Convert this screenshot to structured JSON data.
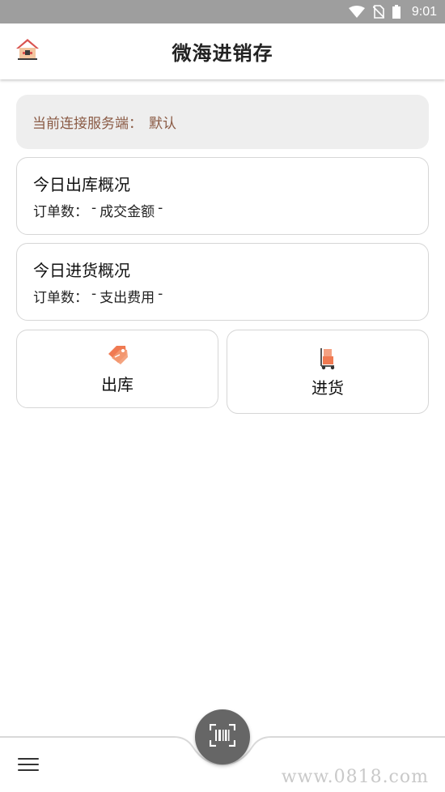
{
  "status_bar": {
    "time": "9:01",
    "icons": [
      "wifi-icon",
      "no-sim-icon",
      "battery-icon"
    ]
  },
  "app_bar": {
    "title": "微海进销存",
    "home_icon": "home-icon"
  },
  "server": {
    "label": "当前连接服务端：",
    "value": "默认"
  },
  "outbound_summary": {
    "title": "今日出库概况",
    "orders_label": "订单数：",
    "orders_value": "-",
    "amount_label": "成交金额",
    "amount_value": "-"
  },
  "inbound_summary": {
    "title": "今日进货概况",
    "orders_label": "订单数：",
    "orders_value": "-",
    "cost_label": "支出费用",
    "cost_value": "-"
  },
  "actions": {
    "outbound": {
      "label": "出库",
      "icon": "price-tag-icon"
    },
    "inbound": {
      "label": "进货",
      "icon": "hand-truck-icon"
    }
  },
  "bottom_bar": {
    "menu_icon": "menu-icon",
    "scan_icon": "barcode-scan-icon"
  },
  "watermark": "www.0818.com",
  "colors": {
    "status_bar_bg": "#9e9e9e",
    "server_text": "#8a5a44",
    "accent_orange": "#f07a52",
    "fab_bg": "#666666"
  }
}
